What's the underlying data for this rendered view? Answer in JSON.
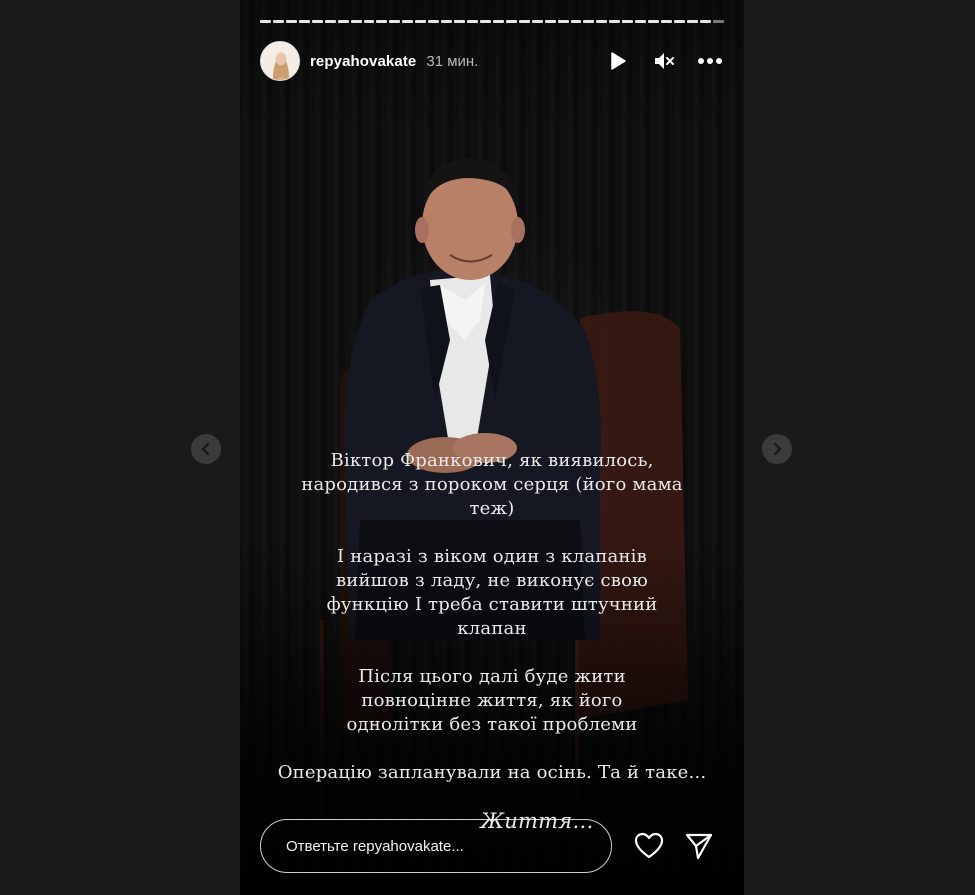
{
  "story": {
    "username": "repyahovakate",
    "time_ago": "31 мин.",
    "progress_segments": 36,
    "caption": {
      "paragraphs": [
        "Віктор Франкович, як виявилось, народився з пороком серця (його мама теж)",
        "І наразі з віком один з клапанів вийшов з ладу, не виконує свою функцію І треба ставити штучний клапан",
        "Після цього далі буде жити повноцінне життя, як його однолітки без такої проблеми",
        "Операцію запланували на осінь. Та й таке..."
      ],
      "signature": "Життя…"
    }
  },
  "reply": {
    "placeholder": "Ответьте repyahovakate..."
  },
  "icons": {
    "play": "play-icon",
    "mute": "speaker-muted-icon",
    "more": "more-horizontal-icon",
    "like": "heart-icon",
    "share": "paper-plane-icon",
    "prev": "chevron-left-icon",
    "next": "chevron-right-icon"
  },
  "colors": {
    "background": "#1a1a1a",
    "text": "#ffffff",
    "nav_button": "#3b3b3b"
  }
}
